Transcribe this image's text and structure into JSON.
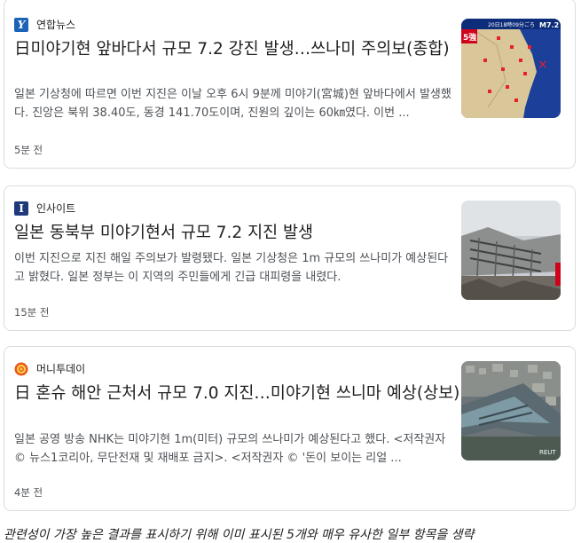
{
  "articles": [
    {
      "source": "연합뉴스",
      "title": "日미야기현 앞바다서 규모 7.2 강진 발생…쓰나미 주의보(종합)",
      "snippet": "일본 기상청에 따르면 이번 지진은 이날 오후 6시 9분께 미야기(宮城)현 앞바다에서 발생했다. 진앙은 북위 38.40도, 동경 141.70도이며, 진원의 깊이는 60㎞였다. 이번 ...",
      "time": "5분 전",
      "thumb_label": "20日18時09分ごろ",
      "thumb_mag": "M7.2",
      "thumb_intensity": "5強"
    },
    {
      "source": "인사이트",
      "title": "일본 동북부 미야기현서 규모 7.2 지진 발생",
      "snippet": "이번 지진으로 지진 해일 주의보가 발령됐다. 일본 기상청은 1m 규모의 쓰나미가 예상된다고 밝혔다. 일본 정부는 이 지역의 주민들에게 긴급 대피령을 내렸다.",
      "time": "15분 전"
    },
    {
      "source": "머니투데이",
      "title": "日 혼슈 해안 근처서 규모 7.0 지진…미야기현 쓰니마 예상(상보)",
      "snippet": "일본 공영 방송 NHK는 미야기현 1m(미터) 규모의 쓰나미가 예상된다고 했다. <저작권자 © 뉴스1코리아, 무단전재 및 재배포 금지>. <저작권자 © '돈이 보이는 리얼 ...",
      "time": "4분 전",
      "thumb_watermark": "REUT"
    }
  ],
  "footer": {
    "text": "관련성이 가장 높은 결과를 표시하기 위해 이미 표시된 5개와 매우 유사한 일부 항목을 생략"
  },
  "colors": {
    "title": "#1f1f1f",
    "snippet": "#4d5156",
    "border": "#dadce0"
  }
}
